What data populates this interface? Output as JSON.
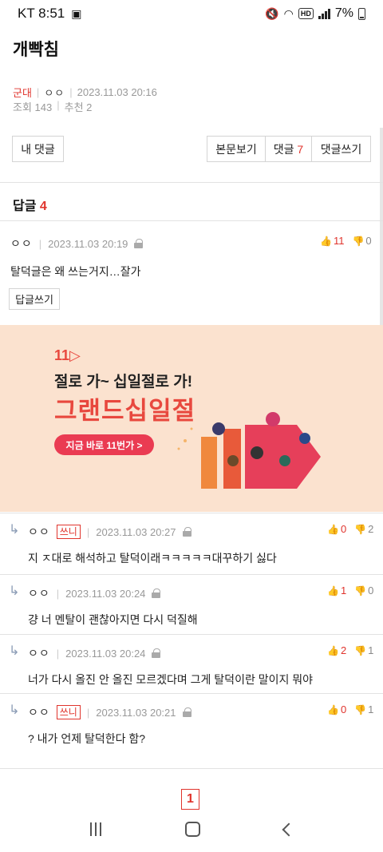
{
  "status_bar": {
    "carrier_time": "KT 8:51",
    "battery": "7%"
  },
  "post": {
    "title": "개빡침",
    "category": "군대",
    "author": "ㅇㅇ",
    "datetime": "2023.11.03 20:16",
    "views": "조회 143",
    "likes": "추천 2"
  },
  "buttons": {
    "my_comments": "내 댓글",
    "view_post": "본문보기",
    "comments_label": "댓글",
    "comments_count": "7",
    "write_comment": "댓글쓰기"
  },
  "replies_header": {
    "label": "답글",
    "count": "4"
  },
  "main_comment": {
    "nick": "ㅇㅇ",
    "datetime": "2023.11.03 20:19",
    "text": "탈덕글은 왜 쓰는거지…잘가",
    "up": "11",
    "down": "0",
    "reply_button": "답글쓰기"
  },
  "ad": {
    "logo": "11",
    "line1": "절로 가~ 십일절로 가!",
    "line2": "그랜드십일절",
    "cta": "지금 바로 11번가 >"
  },
  "replies": [
    {
      "nick": "ㅇㅇ",
      "writer_badge": "쓰니",
      "datetime": "2023.11.03 20:27",
      "text": "지 ㅈ대로 해석하고 탈덕이래ㅋㅋㅋㅋㅋ대꾸하기 싫다",
      "up": "0",
      "down": "2"
    },
    {
      "nick": "ㅇㅇ",
      "writer_badge": "",
      "datetime": "2023.11.03 20:24",
      "text": "걍 너 멘탈이 괜찮아지면 다시 덕질해",
      "up": "1",
      "down": "0"
    },
    {
      "nick": "ㅇㅇ",
      "writer_badge": "",
      "datetime": "2023.11.03 20:24",
      "text": "너가 다시 올진 안 올진 모르겠다며 그게 탈덕이란 말이지 뭐야",
      "up": "2",
      "down": "1"
    },
    {
      "nick": "ㅇㅇ",
      "writer_badge": "쓰니",
      "datetime": "2023.11.03 20:21",
      "text": "? 내가 언제 탈덕한다 함?",
      "up": "0",
      "down": "1"
    }
  ],
  "pagination": {
    "current": "1"
  },
  "icons": {
    "accent": "#e0342d",
    "reply_arrow": "reply-arrow-icon",
    "thumb_up": "thumb-up-icon",
    "thumb_down": "thumb-down-icon",
    "lock": "lock-icon"
  }
}
